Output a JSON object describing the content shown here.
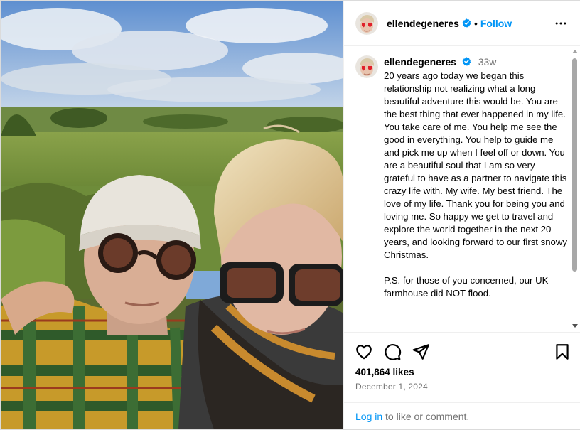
{
  "post": {
    "username": "ellendegeneres",
    "separator": "•",
    "follow_label": "Follow",
    "more_icon": "more-options-icon",
    "verified_color": "#0095f6",
    "accent_color": "#0095f6"
  },
  "caption": {
    "username": "ellendegeneres",
    "time_ago": "33w",
    "text": "20 years ago today we began this relationship not realizing what a long beautiful adventure this would be. You are the best thing that ever happened in my life. You take care of me. You help me see the good in everything. You help to guide me and pick me up when I feel off or down. You are a beautiful soul that I am so very grateful to have as a partner to navigate this crazy life with. My wife. My best friend. The love of my life. Thank you for being you and loving me. So happy we get to travel and explore the world together in the next 20 years, and looking forward to our first snowy Christmas.\n\nP.S. for those of you concerned, our UK farmhouse did NOT flood."
  },
  "actions": {
    "icons": [
      "heart-icon",
      "comment-icon",
      "share-icon",
      "bookmark-icon"
    ]
  },
  "stats": {
    "likes": "401,864 likes",
    "date": "December 1, 2024"
  },
  "login": {
    "link_label": "Log in",
    "rest": " to like or comment."
  }
}
